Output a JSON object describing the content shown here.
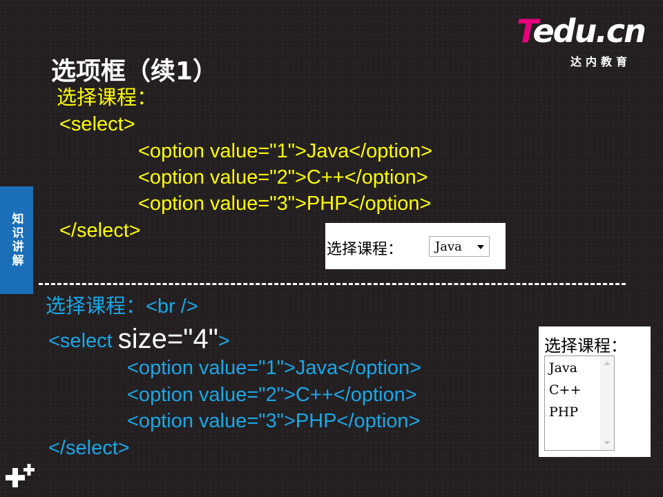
{
  "logo": {
    "brand_t": "T",
    "brand_rest": "edu.cn",
    "subtitle": "达内教育"
  },
  "title": "选项框（续1）",
  "side_tab": "知识讲解",
  "example1": {
    "heading": "选择课程：",
    "lines": [
      "<select>",
      "<option value=\"1\">Java</option>",
      "<option value=\"2\">C++</option>",
      "<option value=\"3\">PHP</option>",
      "</select>"
    ],
    "preview": {
      "label": "选择课程：",
      "selected": "Java"
    }
  },
  "example2": {
    "heading": "选择课程：<br />",
    "select_open": "<select ",
    "size_attr": "size=\"4\"",
    "select_close": ">",
    "lines": [
      "<option value=\"1\">Java</option>",
      "<option value=\"2\">C++</option>",
      "<option value=\"3\">PHP</option>",
      "</select>"
    ],
    "preview": {
      "label": "选择课程：",
      "options": [
        "Java",
        "C++",
        "PHP"
      ]
    }
  },
  "colors": {
    "background": "#231f20",
    "example1_text": "#ffff00",
    "example2_text": "#1aa7e8",
    "side_tab": "#1b6fb8",
    "logo_accent": "#e6007e"
  }
}
